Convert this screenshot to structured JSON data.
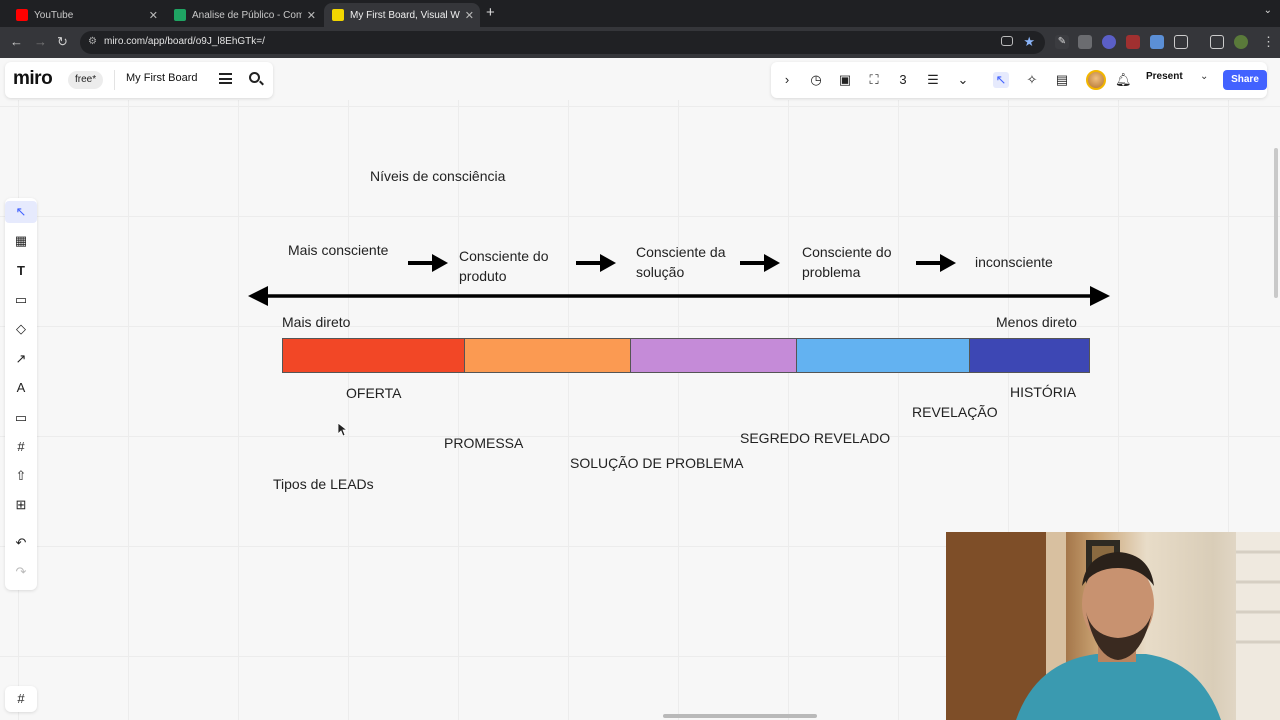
{
  "browser": {
    "tabs": [
      {
        "title": "YouTube",
        "favicon_color": "#ff0000",
        "active": false
      },
      {
        "title": "Analise de Público - Como sa",
        "favicon_color": "#1fa463",
        "active": false
      },
      {
        "title": "My First Board, Visual Works",
        "favicon_color": "#f2d600",
        "active": true
      }
    ],
    "url": "miro.com/app/board/o9J_l8EhGTk=/"
  },
  "miro": {
    "logo": "miro",
    "plan_badge": "free*",
    "board_name": "My First Board",
    "present_label": "Present",
    "share_label": "Share",
    "accent_color": "#4262ff"
  },
  "board": {
    "heading": "Níveis de consciência",
    "stages": [
      {
        "lines": [
          "Mais consciente"
        ]
      },
      {
        "lines": [
          "Consciente do",
          "produto"
        ]
      },
      {
        "lines": [
          "Consciente da",
          "solução"
        ]
      },
      {
        "lines": [
          "Consciente do",
          "problema"
        ]
      },
      {
        "lines": [
          "inconsciente"
        ]
      }
    ],
    "left_end": "Mais direto",
    "right_end": "Menos direto",
    "segment_colors": [
      "#f24726",
      "#fb9a52",
      "#c58bd8",
      "#63b2f1",
      "#3d47b4"
    ],
    "lead_types": [
      "OFERTA",
      "PROMESSA",
      "SOLUÇÃO DE PROBLEMA",
      "SEGREDO REVELADO",
      "REVELAÇÃO",
      "HISTÓRIA"
    ],
    "lead_types_title": "Tipos de LEADs"
  }
}
